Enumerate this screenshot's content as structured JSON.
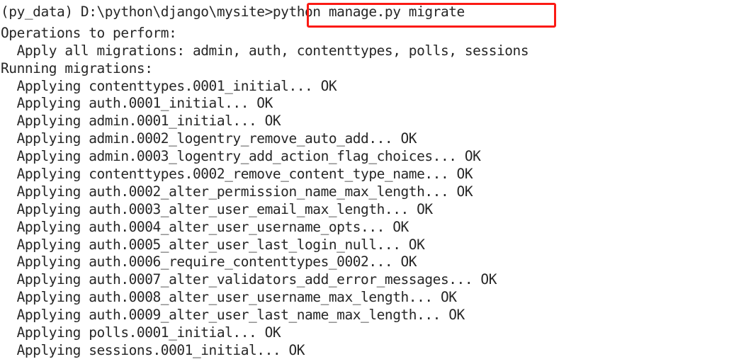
{
  "terminal": {
    "background_color": "#ffffff",
    "text_color": "#262626",
    "prompt": "(py_data) D:\\python\\django\\mysite>",
    "command": "python manage.py migrate",
    "lines": [
      "(py_data) D:\\python\\django\\mysite>python manage.py migrate",
      "Operations to perform:",
      "  Apply all migrations: admin, auth, contenttypes, polls, sessions",
      "Running migrations:",
      "  Applying contenttypes.0001_initial... OK",
      "  Applying auth.0001_initial... OK",
      "  Applying admin.0001_initial... OK",
      "  Applying admin.0002_logentry_remove_auto_add... OK",
      "  Applying admin.0003_logentry_add_action_flag_choices... OK",
      "  Applying contenttypes.0002_remove_content_type_name... OK",
      "  Applying auth.0002_alter_permission_name_max_length... OK",
      "  Applying auth.0003_alter_user_email_max_length... OK",
      "  Applying auth.0004_alter_user_username_opts... OK",
      "  Applying auth.0005_alter_user_last_login_null... OK",
      "  Applying auth.0006_require_contenttypes_0002... OK",
      "  Applying auth.0007_alter_validators_add_error_messages... OK",
      "  Applying auth.0008_alter_user_username_max_length... OK",
      "  Applying auth.0009_alter_user_last_name_max_length... OK",
      "  Applying polls.0001_initial... OK",
      "  Applying sessions.0001_initial... OK"
    ]
  },
  "annotation": {
    "highlight_color": "#fb1a14",
    "highlight_target": "python manage.py migrate"
  }
}
